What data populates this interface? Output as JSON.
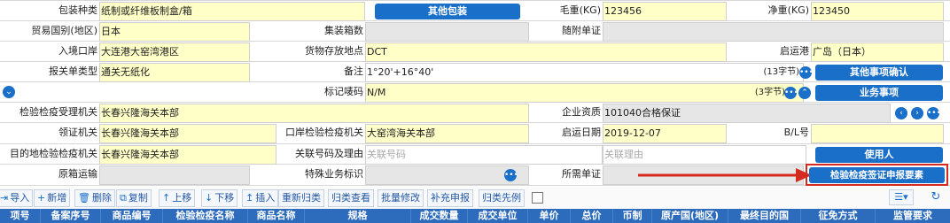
{
  "form": {
    "row1": {
      "pack_label": "包装种类",
      "pack_value": "纸制或纤维板制盒/箱",
      "other_pack_btn": "其他包装",
      "gross_label": "毛重(KG)",
      "gross_value": "123456",
      "net_label": "净重(KG)",
      "net_value": "123450"
    },
    "row2": {
      "trade_country_label": "贸易国别(地区)",
      "trade_country_value": "日本",
      "container_label": "集装箱数",
      "container_value": "",
      "attached_label": "随附单证",
      "attached_value": ""
    },
    "row3": {
      "entry_port_label": "入境口岸",
      "entry_port_value": "大连港大窑湾港区",
      "storage_label": "货物存放地点",
      "storage_value": "DCT",
      "depart_port_label": "启运港",
      "depart_port_value": "广岛（日本）"
    },
    "row4": {
      "decl_type_label": "报关单类型",
      "decl_type_value": "通关无纸化",
      "remark_label": "备注",
      "remark_value": "1°20'+16°40'",
      "remark_count": "(13字节)",
      "other_confirm_btn": "其他事项确认"
    },
    "row5": {
      "marks_label": "标记唛码",
      "marks_value": "N/M",
      "marks_count": "(3字节)",
      "business_btn": "业务事项"
    },
    "row6": {
      "insp_org_label": "检验检疫受理机关",
      "insp_org_value": "长春兴隆海关本部",
      "qualification_label": "企业资质",
      "qualification_value": "101040合格保证"
    },
    "row7": {
      "receive_org_label": "领证机关",
      "receive_org_value": "长春兴隆海关本部",
      "port_insp_label": "口岸检验检疫机关",
      "port_insp_value": "大窑湾海关本部",
      "start_date_label": "启运日期",
      "start_date_value": "2019-12-07",
      "bl_label": "B/L号",
      "bl_value": ""
    },
    "row8": {
      "dest_org_label": "目的地检验检疫机关",
      "dest_org_value": "长春兴隆海关本部",
      "related_no_label": "关联号码及理由",
      "related_no_placeholder": "关联号码",
      "related_reason_placeholder": "关联理由",
      "user_btn": "使用人"
    },
    "row9": {
      "orig_transport_label": "原箱运输",
      "special_label": "特殊业务标识",
      "required_docs_label": "所需单证",
      "insp_cert_btn": "检验检疫签证申报要素"
    }
  },
  "toolbar": {
    "items": [
      {
        "icon": "⇥",
        "label": "导入"
      },
      {
        "icon": "+",
        "label": "新增"
      },
      {
        "icon": "🗑",
        "label": "删除"
      },
      {
        "icon": "⧉",
        "label": "复制"
      },
      {
        "icon": "↑",
        "label": "上移"
      },
      {
        "icon": "↓",
        "label": "下移"
      },
      {
        "icon": "↥",
        "label": "插入"
      },
      {
        "icon": "",
        "label": "重新归类"
      },
      {
        "icon": "",
        "label": "归类查看"
      },
      {
        "icon": "",
        "label": "批量修改"
      },
      {
        "icon": "",
        "label": "补充申报"
      },
      {
        "icon": "",
        "label": "归类先例"
      }
    ]
  },
  "table": {
    "columns": [
      "项号",
      "备案序号",
      "商品编号",
      "检验检疫名称",
      "商品名称",
      "规格",
      "成交数量",
      "成交单位",
      "单价",
      "总价",
      "币制",
      "原产国(地区)",
      "最终目的国",
      "征免方式",
      "监管要求"
    ]
  },
  "colors": {
    "accent": "#1a6fc9",
    "required_field": "#ffffc8",
    "arrow": "#d42a1f"
  }
}
